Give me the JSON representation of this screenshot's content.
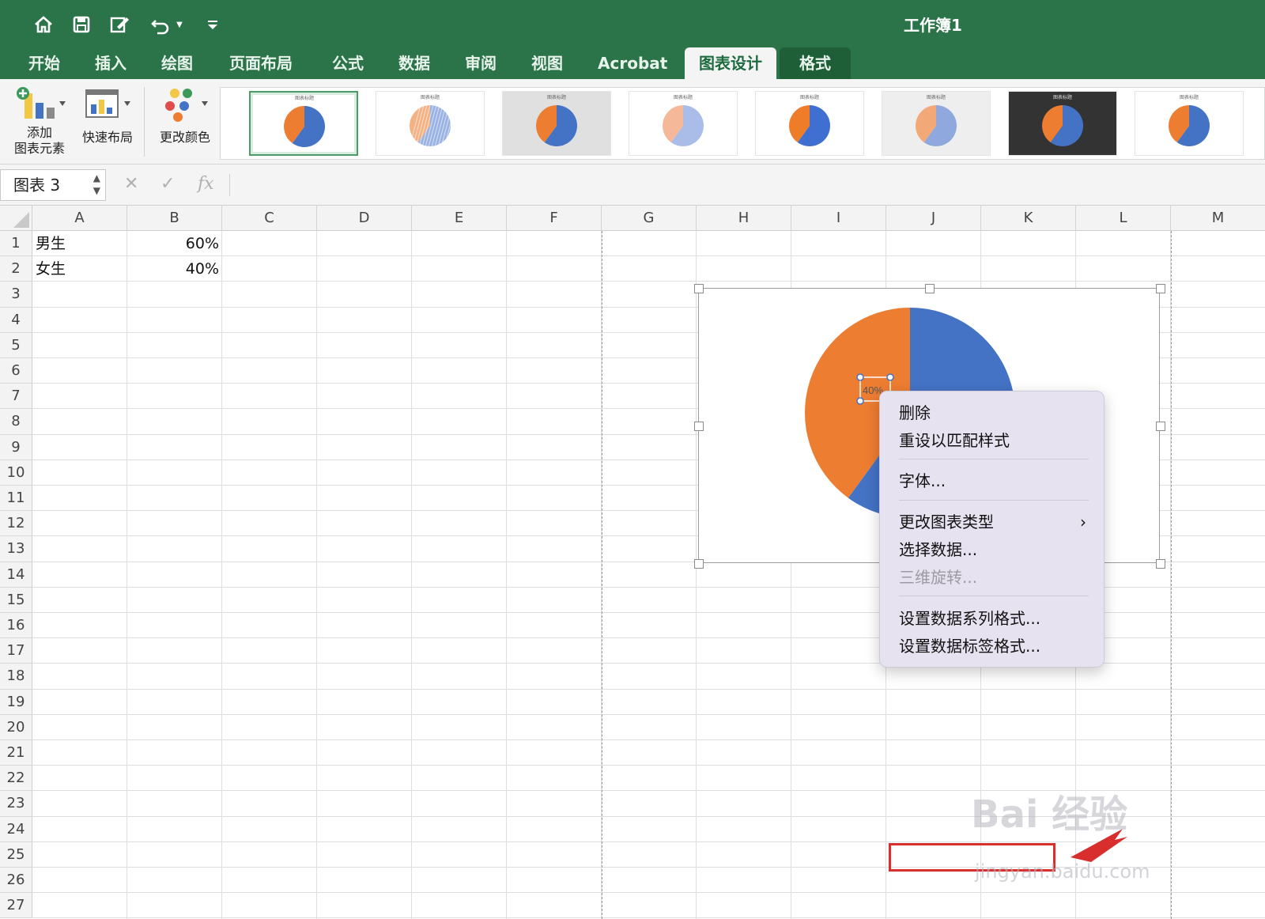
{
  "window": {
    "title": "工作簿1"
  },
  "quick_access": [
    "home-icon",
    "save-icon",
    "edit-icon",
    "undo-icon",
    "customize-icon"
  ],
  "tabs": [
    "开始",
    "插入",
    "绘图",
    "页面布局",
    "公式",
    "数据",
    "审阅",
    "视图",
    "Acrobat",
    "图表设计",
    "格式"
  ],
  "active_tab": "图表设计",
  "ribbon": {
    "add_element": [
      "添加",
      "图表元素"
    ],
    "quick_layout": "快速布局",
    "change_colors": "更改颜色"
  },
  "formula_bar": {
    "name_box": "图表 3",
    "cancel": "✕",
    "enter": "✓",
    "fx": "fx"
  },
  "columns": [
    "A",
    "B",
    "C",
    "D",
    "E",
    "F",
    "G",
    "H",
    "I",
    "J",
    "K",
    "L",
    "M"
  ],
  "rows": [
    "1",
    "2",
    "3",
    "4",
    "5",
    "6",
    "7",
    "8",
    "9",
    "10",
    "11",
    "12",
    "13",
    "14",
    "15",
    "16",
    "17",
    "18",
    "19",
    "20",
    "21",
    "22",
    "23",
    "24",
    "25",
    "26",
    "27"
  ],
  "cells": {
    "A1": "男生",
    "B1": "60%",
    "A2": "女生",
    "B2": "40%"
  },
  "chart_style_thumbnail_titles": [
    "图表标题",
    "图表标题",
    "图表标题",
    "图表标题",
    "图表标题",
    "图表标题",
    "图表标题",
    "图表标题"
  ],
  "chart": {
    "selected_label": "40%"
  },
  "chart_data": {
    "type": "pie",
    "categories": [
      "男生",
      "女生"
    ],
    "values": [
      60,
      40
    ],
    "colors": [
      "#4472c4",
      "#ed7d31"
    ]
  },
  "context_menu": {
    "items": [
      {
        "label": "删除",
        "disabled": false
      },
      {
        "label": "重设以匹配样式",
        "disabled": false
      },
      {
        "label": "字体...",
        "disabled": false
      },
      {
        "label": "更改图表类型",
        "disabled": false,
        "submenu": true
      },
      {
        "label": "选择数据...",
        "disabled": false
      },
      {
        "label": "三维旋转...",
        "disabled": true
      },
      {
        "label": "设置数据系列格式...",
        "disabled": false
      },
      {
        "label": "设置数据标签格式...",
        "disabled": false
      }
    ]
  },
  "watermark": {
    "brand": "Bai 经验",
    "url": "jingyan.baidu.com"
  },
  "colors": {
    "accent": "#2b7348",
    "pie_blue": "#4472c4",
    "pie_orange": "#ed7d31",
    "highlight": "#d82e2e"
  }
}
